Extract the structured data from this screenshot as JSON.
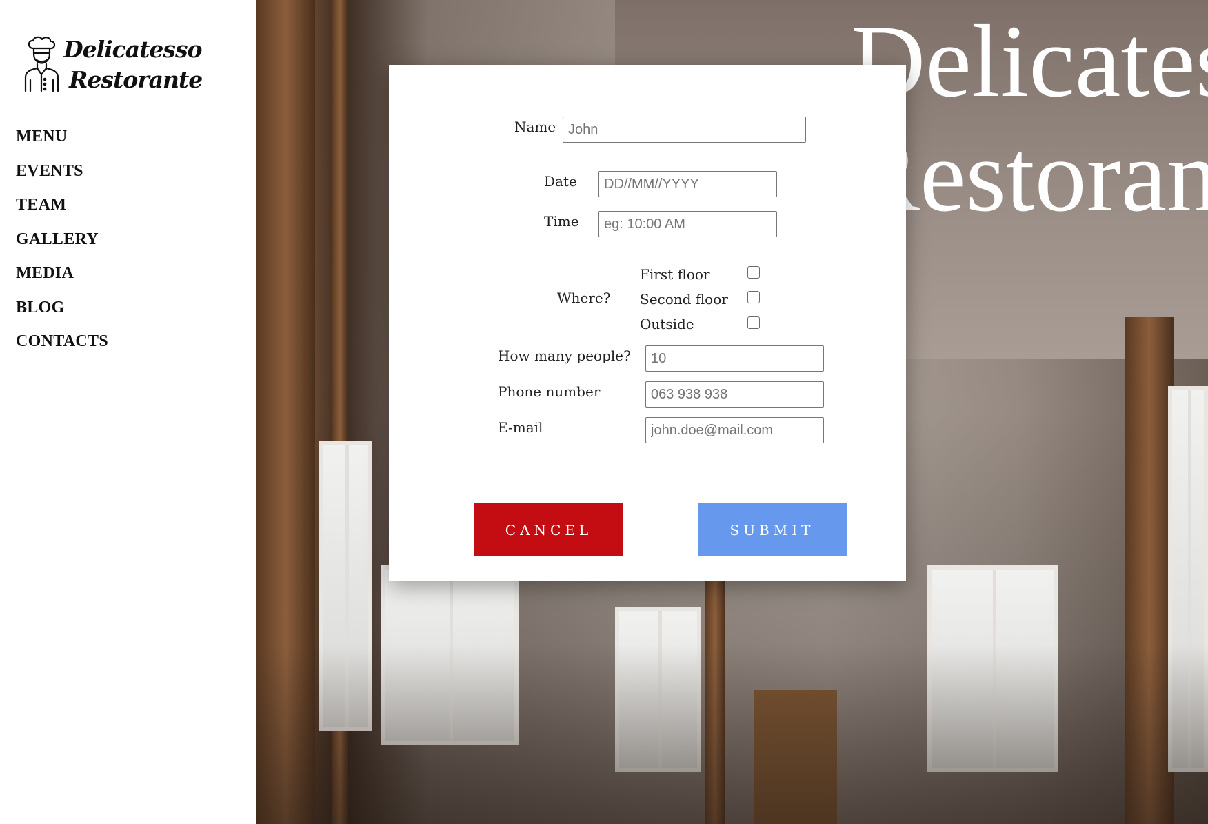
{
  "brand": {
    "line1": "Delicatesso",
    "line2": "Restorante"
  },
  "nav": {
    "items": [
      "MENU",
      "EVENTS",
      "TEAM",
      "GALLERY",
      "MEDIA",
      "BLOG",
      "CONTACTS"
    ]
  },
  "hero": {
    "title_line1": "Delicates",
    "title_line2": "Restorant"
  },
  "form": {
    "name_label": "Name",
    "name_placeholder": "John",
    "date_label": "Date",
    "date_placeholder": "DD//MM//YYYY",
    "time_label": "Time",
    "time_placeholder": "eg: 10:00 AM",
    "where_label": "Where?",
    "where_options": [
      "First floor",
      "Second floor",
      "Outside"
    ],
    "people_label": "How many people?",
    "people_placeholder": "10",
    "phone_label": "Phone number",
    "phone_placeholder": "063 938 938",
    "email_label": "E-mail",
    "email_placeholder": "john.doe@mail.com",
    "cancel_label": "CANCEL",
    "submit_label": "SUBMIT"
  },
  "colors": {
    "cancel": "#c30d13",
    "submit": "#6699ee"
  },
  "icons": {
    "logo": "chef-icon"
  }
}
